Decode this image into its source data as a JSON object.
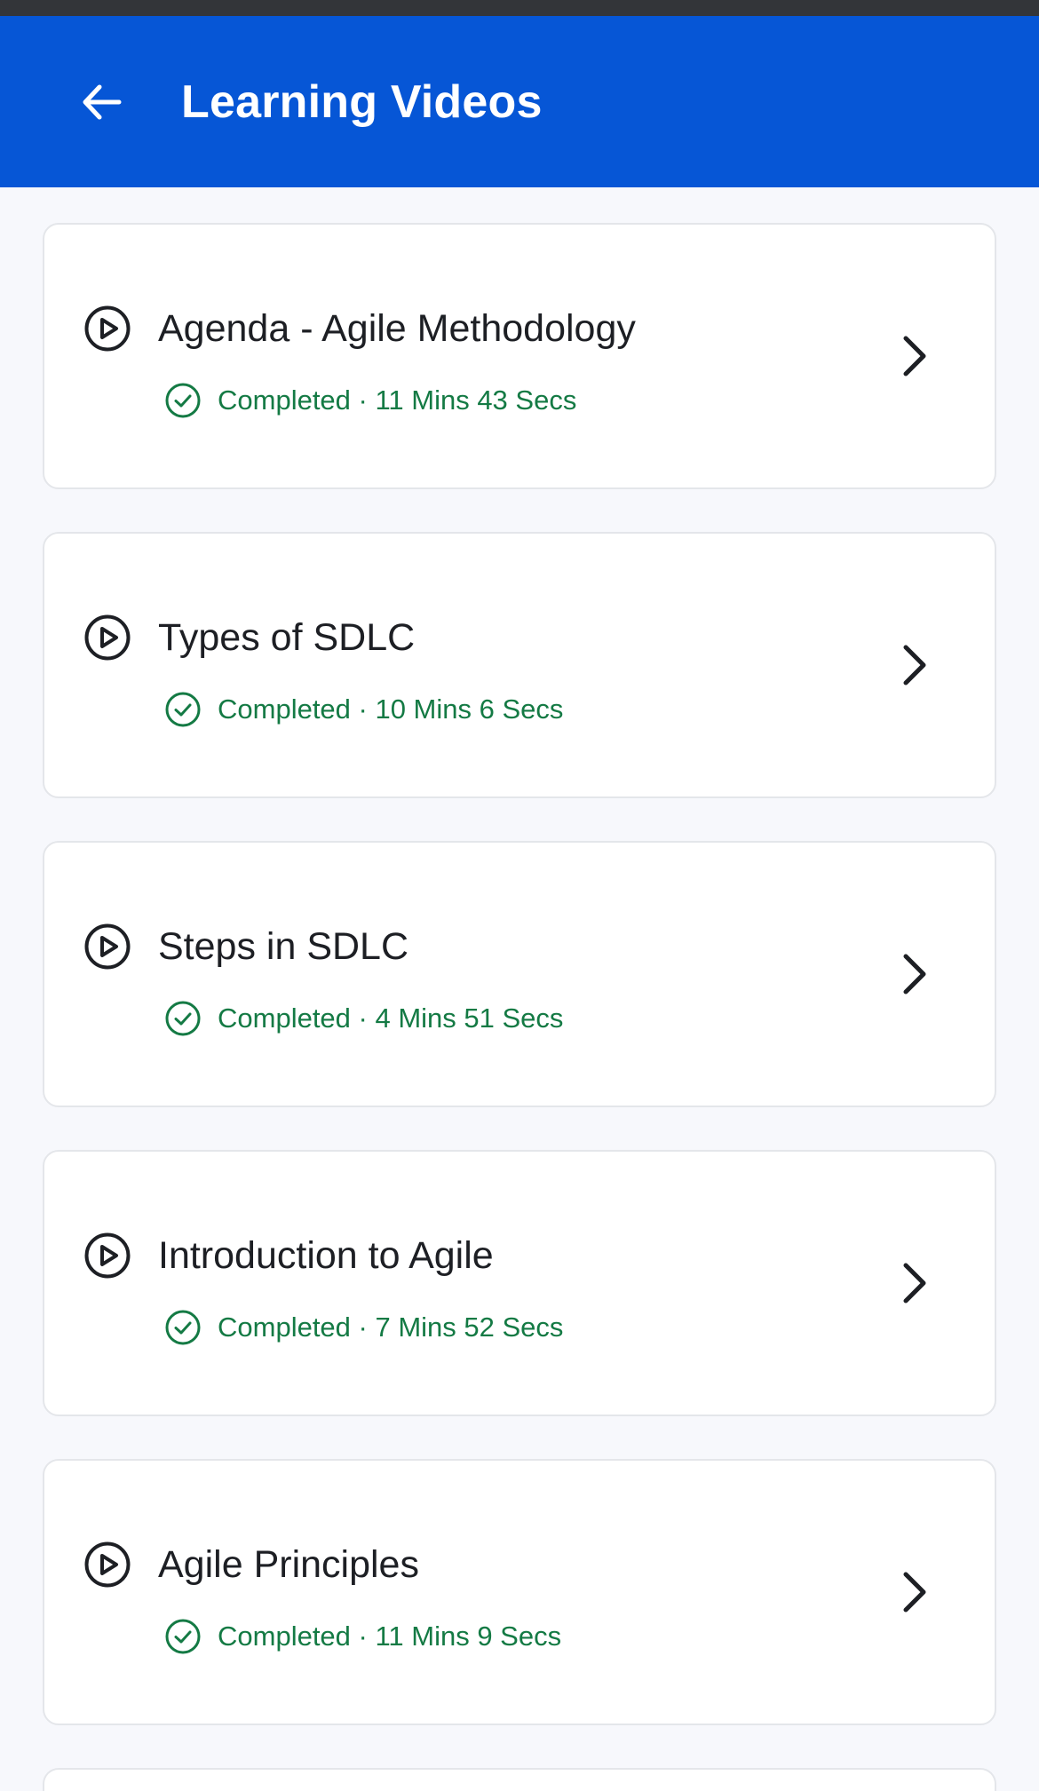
{
  "header": {
    "title": "Learning Videos"
  },
  "videos": [
    {
      "title": "Agenda - Agile Methodology",
      "status": "Completed · 11 Mins 43 Secs"
    },
    {
      "title": "Types of SDLC",
      "status": "Completed · 10 Mins 6 Secs"
    },
    {
      "title": "Steps in SDLC",
      "status": "Completed · 4 Mins 51 Secs"
    },
    {
      "title": "Introduction to Agile",
      "status": "Completed · 7 Mins 52 Secs"
    },
    {
      "title": "Agile Principles",
      "status": "Completed · 11 Mins 9 Secs"
    }
  ],
  "colors": {
    "app_bar": "#0656d6",
    "completed_green": "#147a44",
    "background": "#f7f8fc"
  },
  "icons": {
    "back": "arrow-left-icon",
    "play": "play-circle-icon",
    "check": "check-circle-icon",
    "chevron": "chevron-right-icon"
  }
}
